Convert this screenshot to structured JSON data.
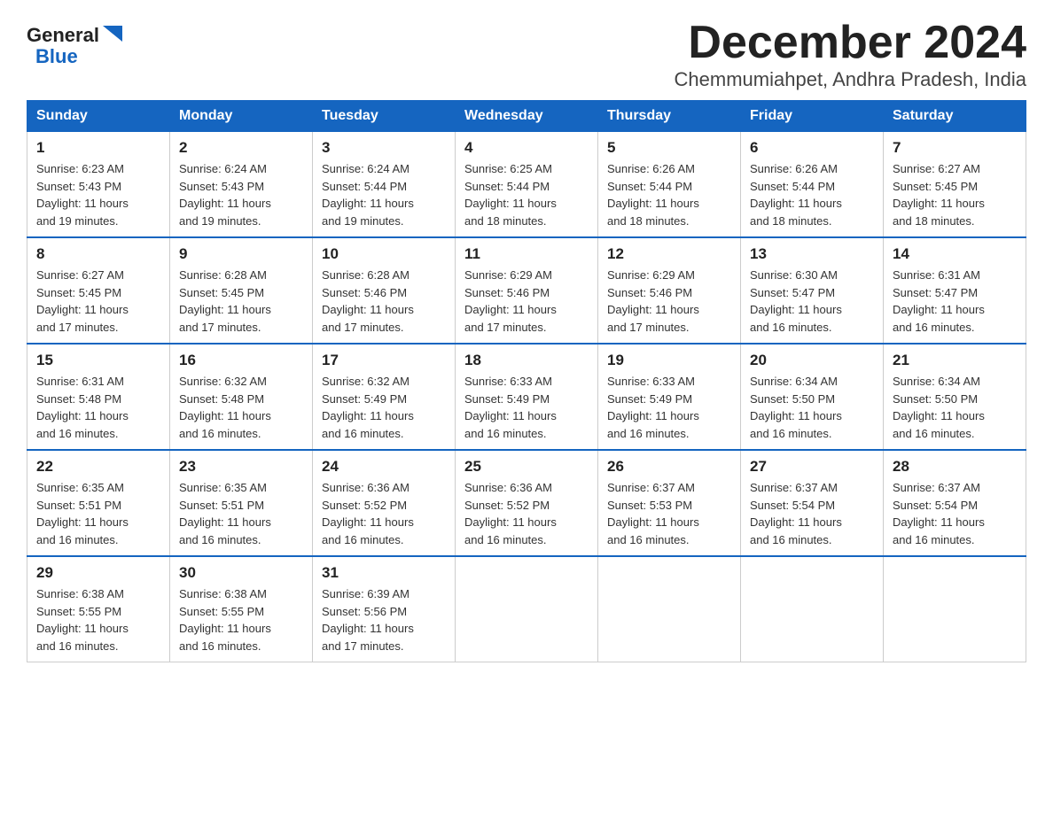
{
  "logo": {
    "general": "General",
    "blue": "Blue",
    "triangle": "▶"
  },
  "title": "December 2024",
  "subtitle": "Chemmumiahpet, Andhra Pradesh, India",
  "days_of_week": [
    "Sunday",
    "Monday",
    "Tuesday",
    "Wednesday",
    "Thursday",
    "Friday",
    "Saturday"
  ],
  "weeks": [
    [
      {
        "day": "1",
        "sunrise": "6:23 AM",
        "sunset": "5:43 PM",
        "daylight": "11 hours and 19 minutes."
      },
      {
        "day": "2",
        "sunrise": "6:24 AM",
        "sunset": "5:43 PM",
        "daylight": "11 hours and 19 minutes."
      },
      {
        "day": "3",
        "sunrise": "6:24 AM",
        "sunset": "5:44 PM",
        "daylight": "11 hours and 19 minutes."
      },
      {
        "day": "4",
        "sunrise": "6:25 AM",
        "sunset": "5:44 PM",
        "daylight": "11 hours and 18 minutes."
      },
      {
        "day": "5",
        "sunrise": "6:26 AM",
        "sunset": "5:44 PM",
        "daylight": "11 hours and 18 minutes."
      },
      {
        "day": "6",
        "sunrise": "6:26 AM",
        "sunset": "5:44 PM",
        "daylight": "11 hours and 18 minutes."
      },
      {
        "day": "7",
        "sunrise": "6:27 AM",
        "sunset": "5:45 PM",
        "daylight": "11 hours and 18 minutes."
      }
    ],
    [
      {
        "day": "8",
        "sunrise": "6:27 AM",
        "sunset": "5:45 PM",
        "daylight": "11 hours and 17 minutes."
      },
      {
        "day": "9",
        "sunrise": "6:28 AM",
        "sunset": "5:45 PM",
        "daylight": "11 hours and 17 minutes."
      },
      {
        "day": "10",
        "sunrise": "6:28 AM",
        "sunset": "5:46 PM",
        "daylight": "11 hours and 17 minutes."
      },
      {
        "day": "11",
        "sunrise": "6:29 AM",
        "sunset": "5:46 PM",
        "daylight": "11 hours and 17 minutes."
      },
      {
        "day": "12",
        "sunrise": "6:29 AM",
        "sunset": "5:46 PM",
        "daylight": "11 hours and 17 minutes."
      },
      {
        "day": "13",
        "sunrise": "6:30 AM",
        "sunset": "5:47 PM",
        "daylight": "11 hours and 16 minutes."
      },
      {
        "day": "14",
        "sunrise": "6:31 AM",
        "sunset": "5:47 PM",
        "daylight": "11 hours and 16 minutes."
      }
    ],
    [
      {
        "day": "15",
        "sunrise": "6:31 AM",
        "sunset": "5:48 PM",
        "daylight": "11 hours and 16 minutes."
      },
      {
        "day": "16",
        "sunrise": "6:32 AM",
        "sunset": "5:48 PM",
        "daylight": "11 hours and 16 minutes."
      },
      {
        "day": "17",
        "sunrise": "6:32 AM",
        "sunset": "5:49 PM",
        "daylight": "11 hours and 16 minutes."
      },
      {
        "day": "18",
        "sunrise": "6:33 AM",
        "sunset": "5:49 PM",
        "daylight": "11 hours and 16 minutes."
      },
      {
        "day": "19",
        "sunrise": "6:33 AM",
        "sunset": "5:49 PM",
        "daylight": "11 hours and 16 minutes."
      },
      {
        "day": "20",
        "sunrise": "6:34 AM",
        "sunset": "5:50 PM",
        "daylight": "11 hours and 16 minutes."
      },
      {
        "day": "21",
        "sunrise": "6:34 AM",
        "sunset": "5:50 PM",
        "daylight": "11 hours and 16 minutes."
      }
    ],
    [
      {
        "day": "22",
        "sunrise": "6:35 AM",
        "sunset": "5:51 PM",
        "daylight": "11 hours and 16 minutes."
      },
      {
        "day": "23",
        "sunrise": "6:35 AM",
        "sunset": "5:51 PM",
        "daylight": "11 hours and 16 minutes."
      },
      {
        "day": "24",
        "sunrise": "6:36 AM",
        "sunset": "5:52 PM",
        "daylight": "11 hours and 16 minutes."
      },
      {
        "day": "25",
        "sunrise": "6:36 AM",
        "sunset": "5:52 PM",
        "daylight": "11 hours and 16 minutes."
      },
      {
        "day": "26",
        "sunrise": "6:37 AM",
        "sunset": "5:53 PM",
        "daylight": "11 hours and 16 minutes."
      },
      {
        "day": "27",
        "sunrise": "6:37 AM",
        "sunset": "5:54 PM",
        "daylight": "11 hours and 16 minutes."
      },
      {
        "day": "28",
        "sunrise": "6:37 AM",
        "sunset": "5:54 PM",
        "daylight": "11 hours and 16 minutes."
      }
    ],
    [
      {
        "day": "29",
        "sunrise": "6:38 AM",
        "sunset": "5:55 PM",
        "daylight": "11 hours and 16 minutes."
      },
      {
        "day": "30",
        "sunrise": "6:38 AM",
        "sunset": "5:55 PM",
        "daylight": "11 hours and 16 minutes."
      },
      {
        "day": "31",
        "sunrise": "6:39 AM",
        "sunset": "5:56 PM",
        "daylight": "11 hours and 17 minutes."
      },
      null,
      null,
      null,
      null
    ]
  ],
  "labels": {
    "sunrise": "Sunrise:",
    "sunset": "Sunset:",
    "daylight": "Daylight:"
  }
}
